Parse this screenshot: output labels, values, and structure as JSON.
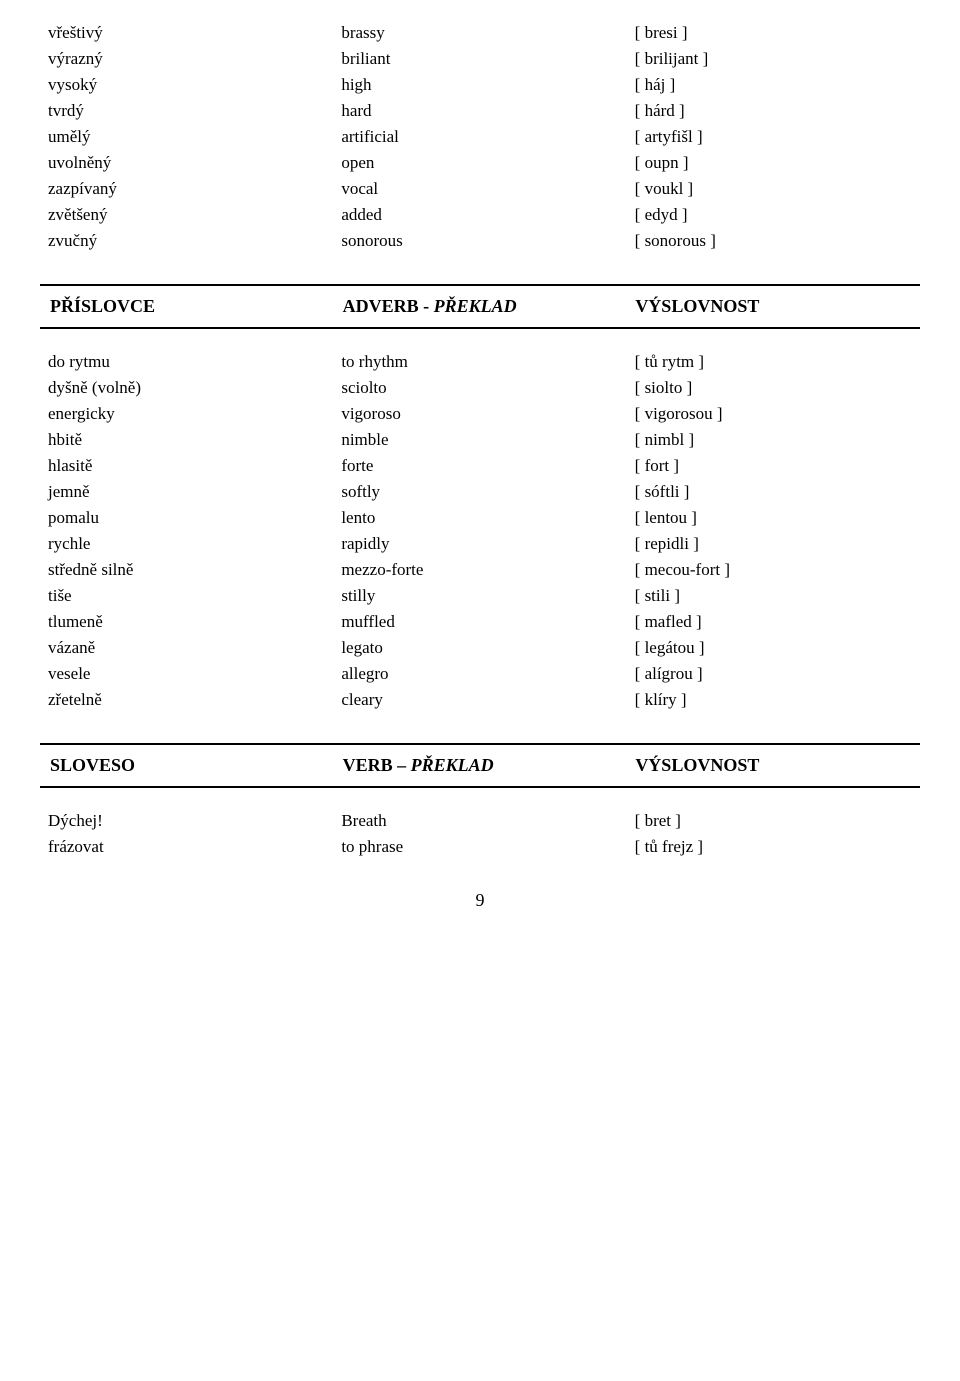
{
  "adjectives_section": {
    "rows": [
      {
        "czech": "vřeštivý",
        "english": "brassy",
        "pronunciation": "[ bresi ]"
      },
      {
        "czech": "výrazný",
        "english": "briliant",
        "pronunciation": "[ brilijant ]"
      },
      {
        "czech": "vysoký",
        "english": "high",
        "pronunciation": "[ háj ]"
      },
      {
        "czech": "tvrdý",
        "english": "hard",
        "pronunciation": "[ hárd ]"
      },
      {
        "czech": "umělý",
        "english": "artificial",
        "pronunciation": "[ artyfišl ]"
      },
      {
        "czech": "uvolněný",
        "english": "open",
        "pronunciation": "[ oupn ]"
      },
      {
        "czech": "zazpívaný",
        "english": "vocal",
        "pronunciation": "[ voukl ]"
      },
      {
        "czech": "zvětšený",
        "english": "added",
        "pronunciation": "[ edyd ]"
      },
      {
        "czech": "zvučný",
        "english": "sonorous",
        "pronunciation": "[ sonorous ]"
      }
    ]
  },
  "adverbs_section": {
    "header": {
      "col1": "PŘÍSLOVCE",
      "col2": "ADVERB - PŘEKLAD",
      "col2_italic": "PŘEKLAD",
      "col3": "VÝSLOVNOST"
    },
    "rows": [
      {
        "czech": "do rytmu",
        "english": "to rhythm",
        "pronunciation": "[ tů rytm ]"
      },
      {
        "czech": "dyšně (volně)",
        "english": "sciolto",
        "pronunciation": "[ siolto ]"
      },
      {
        "czech": "energicky",
        "english": "vigoroso",
        "pronunciation": "[ vigorosou ]"
      },
      {
        "czech": "hbitě",
        "english": "nimble",
        "pronunciation": "[ nimbl ]"
      },
      {
        "czech": "hlasitě",
        "english": "forte",
        "pronunciation": "[ fort ]"
      },
      {
        "czech": "jemně",
        "english": "softly",
        "pronunciation": "[ sóftli ]"
      },
      {
        "czech": "pomalu",
        "english": "lento",
        "pronunciation": "[ lentou ]"
      },
      {
        "czech": "rychle",
        "english": "rapidly",
        "pronunciation": "[ repidli ]"
      },
      {
        "czech": "středně silně",
        "english": "mezzo-forte",
        "pronunciation": "[ mecou-fort ]"
      },
      {
        "czech": "tiše",
        "english": "stilly",
        "pronunciation": "[ stili ]"
      },
      {
        "czech": "tlumeně",
        "english": "muffled",
        "pronunciation": "[ mafled ]"
      },
      {
        "czech": "vázaně",
        "english": "legato",
        "pronunciation": "[ legátou ]"
      },
      {
        "czech": "vesele",
        "english": "allegro",
        "pronunciation": "[ alígrou ]"
      },
      {
        "czech": "zřetelně",
        "english": "cleary",
        "pronunciation": "[ klíry ]"
      }
    ]
  },
  "verbs_section": {
    "header": {
      "col1": "SLOVESO",
      "col2": "VERB – PŘEKLAD",
      "col2_italic": "PŘEKLAD",
      "col3": "VÝSLOVNOST"
    },
    "rows": [
      {
        "czech": "Dýchej!",
        "english": "Breath",
        "pronunciation": "[ bret ]"
      },
      {
        "czech": "frázovat",
        "english": "to phrase",
        "pronunciation": "[ tů frejz ]"
      }
    ]
  },
  "page_number": "9"
}
